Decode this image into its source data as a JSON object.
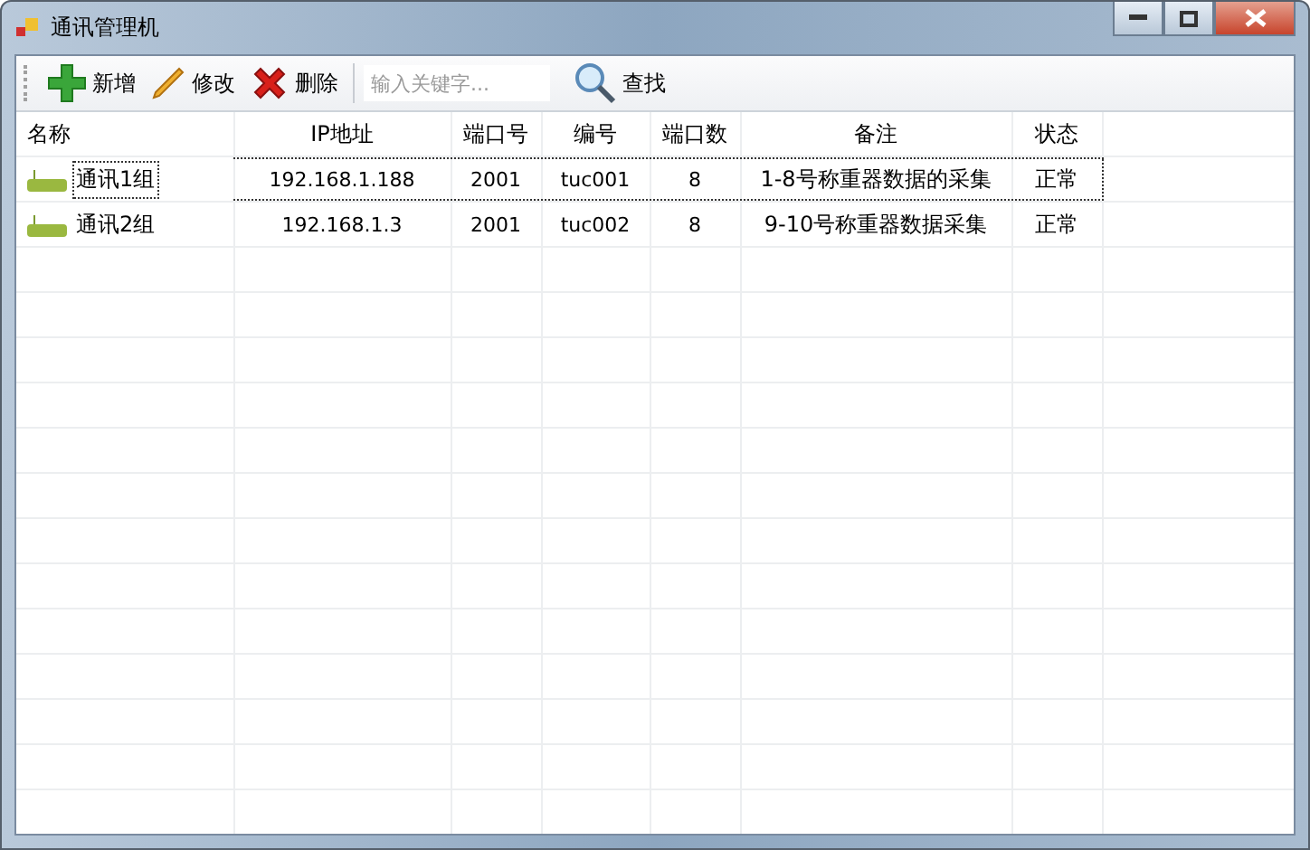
{
  "window": {
    "title": "通讯管理机"
  },
  "toolbar": {
    "buttons": [
      {
        "kind": "add",
        "label": "新增"
      },
      {
        "kind": "edit",
        "label": "修改"
      },
      {
        "kind": "delete",
        "label": "删除"
      }
    ],
    "search": {
      "placeholder": "输入关键字..."
    },
    "find": {
      "kind": "search",
      "label": "查找"
    }
  },
  "table": {
    "columns": [
      "名称",
      "IP地址",
      "端口号",
      "编号",
      "端口数",
      "备注",
      "状态"
    ],
    "rows": [
      {
        "focused": true,
        "cells": [
          "通讯1组",
          "192.168.1.188",
          "2001",
          "tuc001",
          "8",
          "1-8号称重器数据的采集",
          "正常"
        ]
      },
      {
        "focused": false,
        "cells": [
          "通讯2组",
          "192.168.1.3",
          "2001",
          "tuc002",
          "8",
          "9-10号称重器数据采集",
          "正常"
        ]
      }
    ]
  }
}
